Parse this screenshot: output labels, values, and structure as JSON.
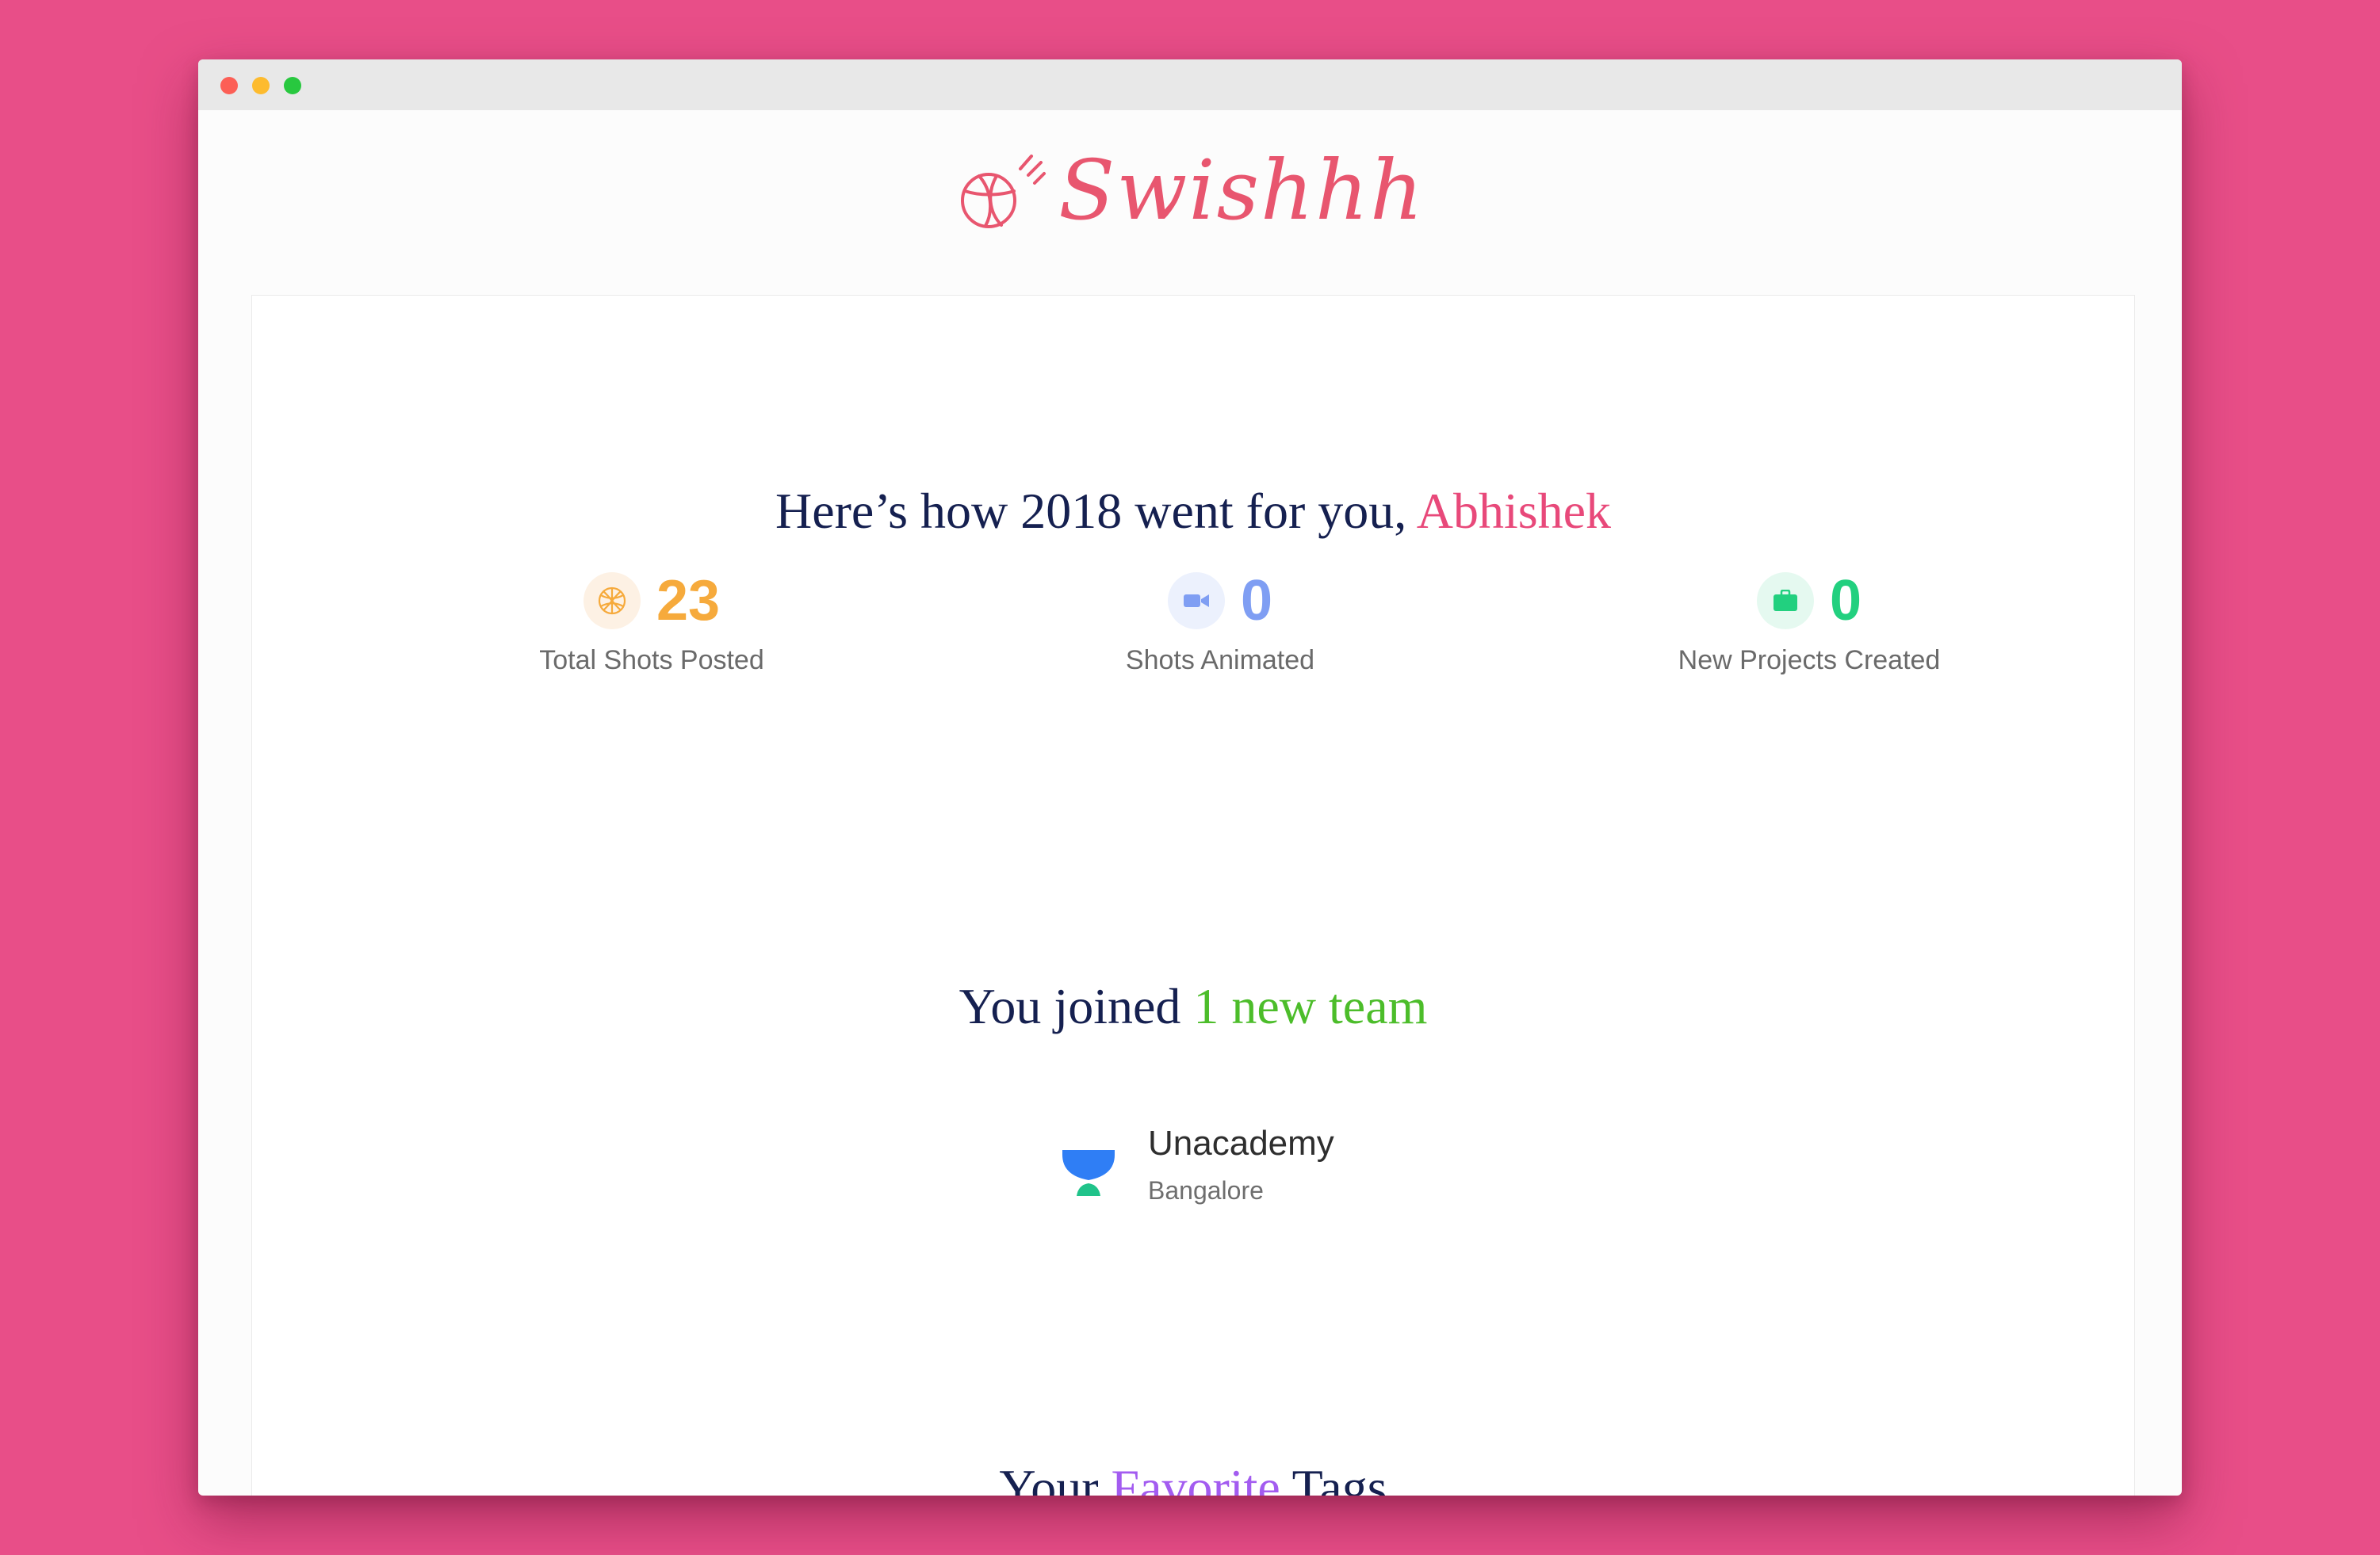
{
  "brand": {
    "name": "Swishhh"
  },
  "headline": {
    "prefix": "Here’s how 2018 went for you, ",
    "name": "Abhishek"
  },
  "stats": [
    {
      "icon": "basketball-icon",
      "value": "23",
      "label": "Total Shots Posted",
      "color": "#f6aa3c"
    },
    {
      "icon": "video-camera-icon",
      "value": "0",
      "label": "Shots Animated",
      "color": "#7f9ef3"
    },
    {
      "icon": "briefcase-icon",
      "value": "0",
      "label": "New Projects Created",
      "color": "#22d07f"
    }
  ],
  "teams": {
    "title_prefix": "You joined ",
    "title_accent": "1 new team",
    "items": [
      {
        "name": "Unacademy",
        "location": "Bangalore",
        "icon": "unacademy-logo-icon"
      }
    ]
  },
  "tags": {
    "title_prefix": "Your ",
    "title_accent": "Favorite",
    "title_suffix": " Tags"
  },
  "colors": {
    "background": "#e84e88",
    "brand": "#e8566f",
    "name_accent": "#e8497a",
    "team_accent": "#4cbd2a",
    "tags_accent": "#a35cf0",
    "title_text": "#152050"
  }
}
